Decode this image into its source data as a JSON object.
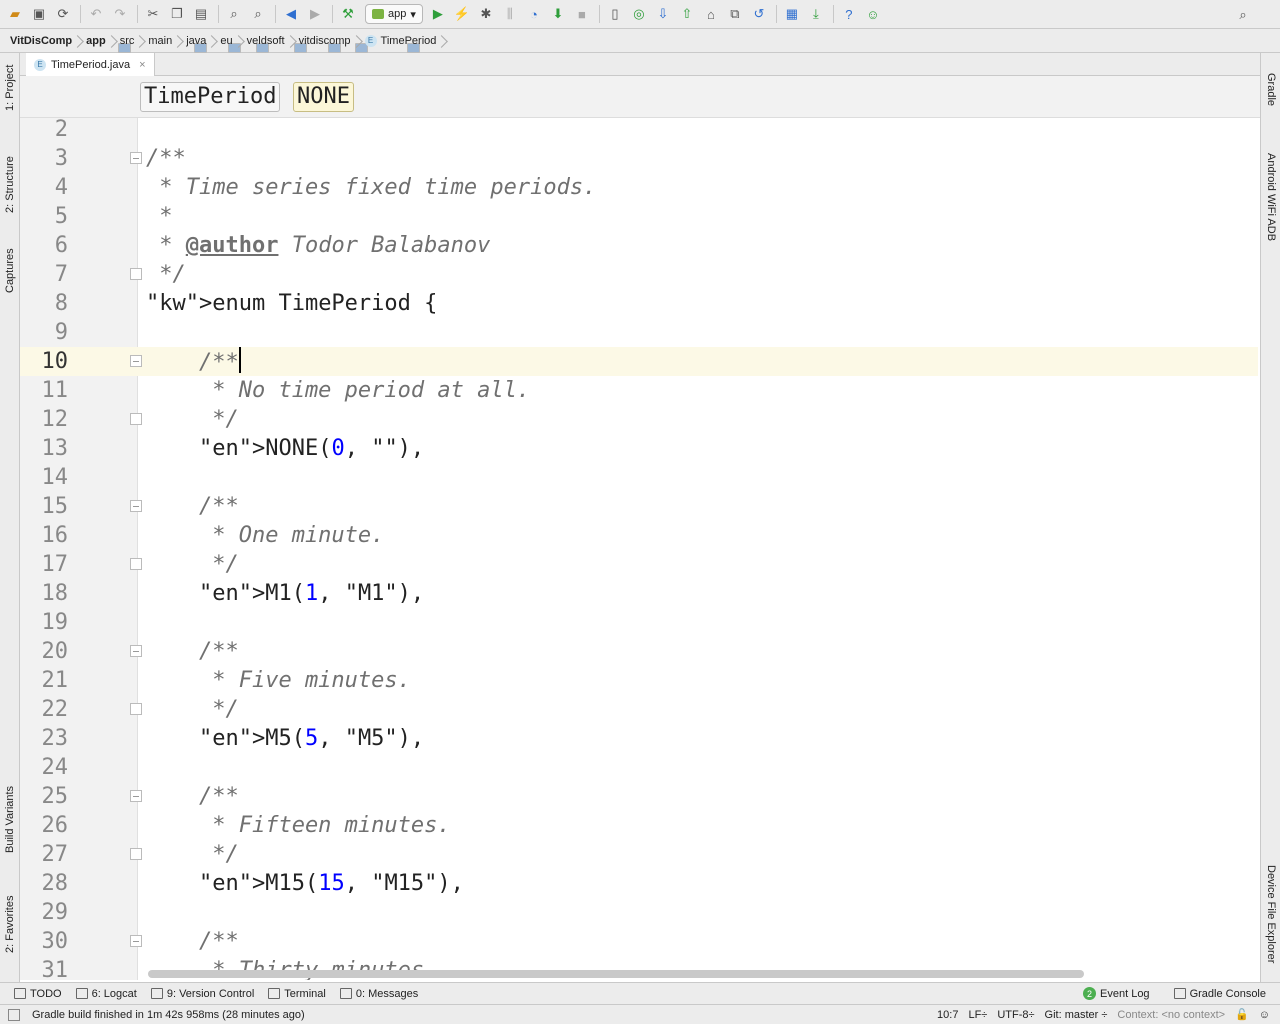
{
  "toolbar": {
    "run_config": "app",
    "icons": [
      "open-folder-icon",
      "save-icon",
      "sync-icon",
      "undo-icon",
      "redo-icon",
      "cut-icon",
      "copy-icon",
      "paste-icon",
      "find-icon",
      "replace-icon",
      "back-icon",
      "forward-icon",
      "build-icon",
      "run-icon",
      "apply-changes-icon",
      "debug-icon",
      "attach-debugger-icon",
      "profile-icon",
      "sdk-manager-icon",
      "stop-icon",
      "avd-manager-icon",
      "sync-gradle-icon",
      "vcs-update-icon",
      "vcs-commit-icon",
      "vcs-history-icon",
      "vcs-compare-icon",
      "revert-icon",
      "project-structure-icon",
      "device-download-icon",
      "help-icon",
      "android-icon"
    ]
  },
  "breadcrumb": [
    "VitDisComp",
    "app",
    "src",
    "main",
    "java",
    "eu",
    "veldsoft",
    "vitdiscomp",
    "TimePeriod"
  ],
  "file_tab": {
    "label": "TimePeriod.java",
    "close": "×",
    "icon": "E"
  },
  "navbar": {
    "class_chip": "TimePeriod",
    "member_chip": "NONE"
  },
  "left_tools": {
    "project": "1: Project",
    "structure": "2: Structure",
    "captures": "Captures",
    "build_variants": "Build Variants",
    "favorites": "2: Favorites"
  },
  "right_tools": {
    "gradle": "Gradle",
    "wifi_adb": "Android WiFi ADB",
    "device_explorer": "Device File Explorer"
  },
  "editor": {
    "current_line": 10,
    "lines": [
      {
        "n": "2",
        "t": ""
      },
      {
        "n": "3",
        "t": "/**"
      },
      {
        "n": "4",
        "t": " * Time series fixed time periods."
      },
      {
        "n": "5",
        "t": " *"
      },
      {
        "n": "6",
        "t": " * @author Todor Balabanov"
      },
      {
        "n": "7",
        "t": " */"
      },
      {
        "n": "8",
        "t": "enum TimePeriod {"
      },
      {
        "n": "9",
        "t": ""
      },
      {
        "n": "10",
        "t": "    /**"
      },
      {
        "n": "11",
        "t": "     * No time period at all."
      },
      {
        "n": "12",
        "t": "     */"
      },
      {
        "n": "13",
        "t": "    NONE(0, \"\"),"
      },
      {
        "n": "14",
        "t": ""
      },
      {
        "n": "15",
        "t": "    /**"
      },
      {
        "n": "16",
        "t": "     * One minute."
      },
      {
        "n": "17",
        "t": "     */"
      },
      {
        "n": "18",
        "t": "    M1(1, \"M1\"),"
      },
      {
        "n": "19",
        "t": ""
      },
      {
        "n": "20",
        "t": "    /**"
      },
      {
        "n": "21",
        "t": "     * Five minutes."
      },
      {
        "n": "22",
        "t": "     */"
      },
      {
        "n": "23",
        "t": "    M5(5, \"M5\"),"
      },
      {
        "n": "24",
        "t": ""
      },
      {
        "n": "25",
        "t": "    /**"
      },
      {
        "n": "26",
        "t": "     * Fifteen minutes."
      },
      {
        "n": "27",
        "t": "     */"
      },
      {
        "n": "28",
        "t": "    M15(15, \"M15\"),"
      },
      {
        "n": "29",
        "t": ""
      },
      {
        "n": "30",
        "t": "    /**"
      },
      {
        "n": "31",
        "t": "     * Thirty minutes."
      }
    ]
  },
  "tool_windows": {
    "todo": "TODO",
    "logcat": "6: Logcat",
    "vcs": "9: Version Control",
    "terminal": "Terminal",
    "messages": "0: Messages",
    "event_log": "Event Log",
    "event_count": "2",
    "gradle_console": "Gradle Console"
  },
  "status": {
    "message": "Gradle build finished in 1m 42s 958ms (28 minutes ago)",
    "position": "10:7",
    "line_sep": "LF÷",
    "encoding": "UTF-8÷",
    "git": "Git: master ÷",
    "context": "Context: <no context>"
  },
  "colors": {
    "keyword": "#000080",
    "enum_const": "#660e7a",
    "number": "#0000ff",
    "string": "#008000",
    "comment": "#707070",
    "current_line": "#fcf9e6"
  }
}
